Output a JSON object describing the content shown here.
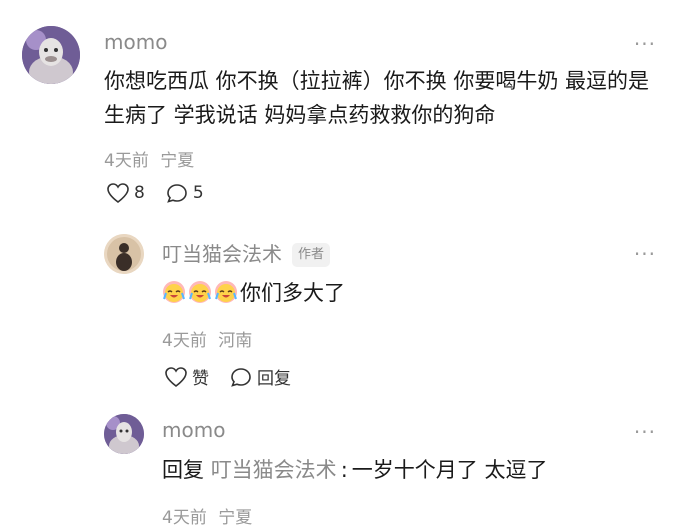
{
  "comments": [
    {
      "username": "momo",
      "text": "你想吃西瓜 你不换（拉拉裤）你不换 你要喝牛奶 最逗的是生病了 学我说话 妈妈拿点药救救你的狗命",
      "time": "4天前",
      "location": "宁夏",
      "likes": "8",
      "replies": "5"
    },
    {
      "username": "叮当猫会法术",
      "author_tag": "作者",
      "text": "你们多大了",
      "emojis": [
        "crying-laugh-emoji",
        "crying-laugh-emoji",
        "crying-laugh-emoji"
      ],
      "time": "4天前",
      "location": "河南",
      "like_label": "赞",
      "reply_label": "回复"
    },
    {
      "username": "momo",
      "reply_prefix": "回复",
      "reply_to": "叮当猫会法术",
      "separator": ":",
      "text": "一岁十个月了 太逗了",
      "time": "4天前",
      "location": "宁夏"
    }
  ],
  "more_label": "···",
  "colors": {
    "muted": "#8a8a8a",
    "text": "#1a1a1a",
    "tag_bg": "#f1f1f1"
  }
}
